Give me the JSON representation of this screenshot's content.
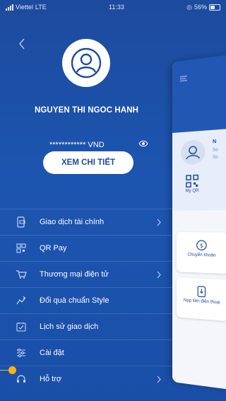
{
  "status_bar": {
    "carrier": "Viettel",
    "network": "LTE",
    "time": "11:33",
    "battery": "56%"
  },
  "profile": {
    "name": "NGUYEN THI NGOC HANH",
    "balance_masked": "************ VND",
    "detail_button": "XEM CHI TIẾT"
  },
  "menu": [
    {
      "label": "Giao dịch tài chính",
      "icon": "wallet-phone-icon",
      "chevron": true
    },
    {
      "label": "QR Pay",
      "icon": "qr-code-icon",
      "chevron": false
    },
    {
      "label": "Thương mại điện tử",
      "icon": "shopping-cart-icon",
      "chevron": true
    },
    {
      "label": "Đổi quà chuẩn Style",
      "icon": "gift-icon",
      "chevron": false
    },
    {
      "label": "Lịch sử giao dịch",
      "icon": "history-icon",
      "chevron": false
    },
    {
      "label": "Cài đặt",
      "icon": "settings-sliders-icon",
      "chevron": false
    },
    {
      "label": "Hỗ trợ",
      "icon": "support-icon",
      "chevron": true
    }
  ],
  "background_panel": {
    "initial": "N",
    "line2": "So",
    "line3": "So",
    "qr_label": "My QR",
    "cards": [
      {
        "label": "Chuyển khoản",
        "icon": "transfer-icon"
      },
      {
        "label": "Nạp tiền điện thoại",
        "icon": "phone-topup-icon"
      }
    ]
  },
  "colors": {
    "primary": "#1d4b9e",
    "accent": "#f7b31a",
    "white": "#ffffff"
  }
}
